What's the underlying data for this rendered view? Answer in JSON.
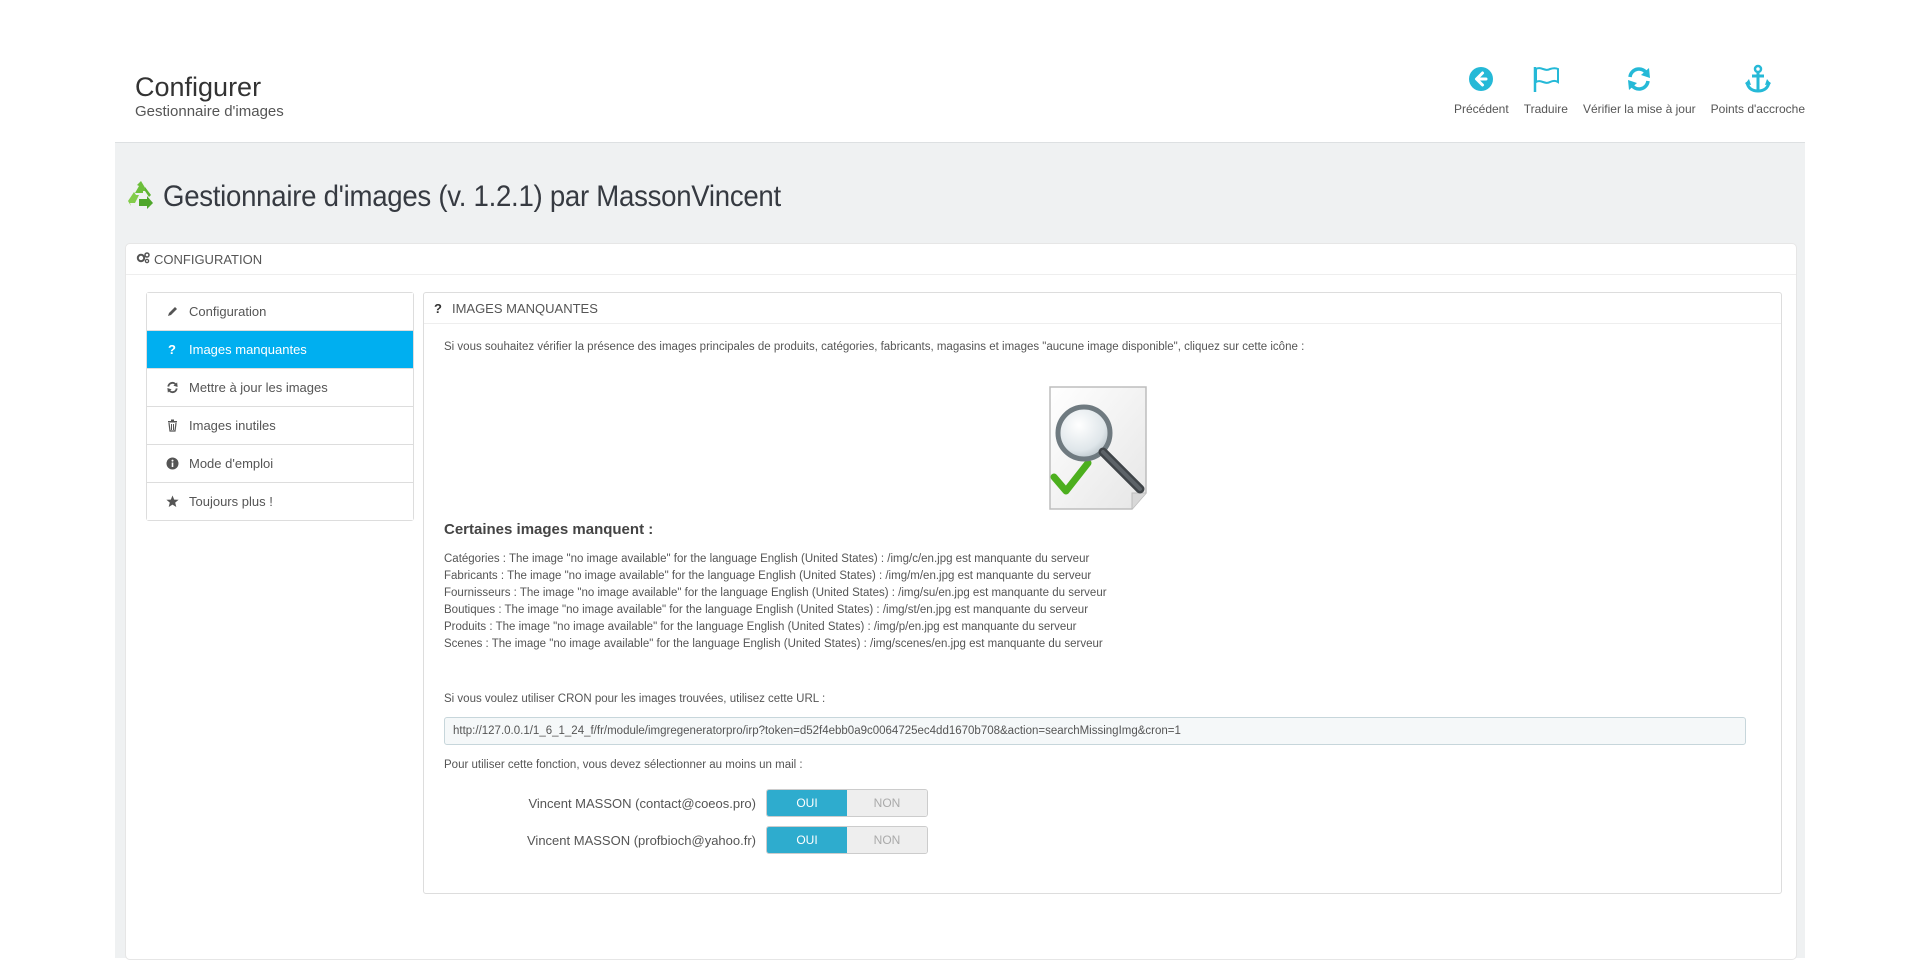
{
  "header": {
    "title": "Configurer",
    "breadcrumb": "Gestionnaire d'images"
  },
  "toolbar": [
    {
      "label": "Précédent",
      "icon": "arrow-circle-left-icon"
    },
    {
      "label": "Traduire",
      "icon": "flag-icon"
    },
    {
      "label": "Vérifier la mise à jour",
      "icon": "refresh-icon"
    },
    {
      "label": "Points d'accroche",
      "icon": "anchor-icon"
    }
  ],
  "module": {
    "title": "Gestionnaire d'images (v. 1.2.1) par MassonVincent",
    "icon": "recycle-icon"
  },
  "panel": {
    "heading": "Configuration"
  },
  "sidebar": {
    "items": [
      {
        "label": "Configuration",
        "icon": "pencil-icon",
        "active": false
      },
      {
        "label": "Images manquantes",
        "icon": "question-icon",
        "active": true
      },
      {
        "label": "Mettre à jour les images",
        "icon": "refresh-icon",
        "active": false
      },
      {
        "label": "Images inutiles",
        "icon": "trash-icon",
        "active": false
      },
      {
        "label": "Mode d'emploi",
        "icon": "info-icon",
        "active": false
      },
      {
        "label": "Toujours plus !",
        "icon": "star-icon",
        "active": false
      }
    ]
  },
  "main": {
    "heading": "Images manquantes",
    "intro": "Si vous souhaitez vérifier la présence des images principales de produits, catégories, fabricants, magasins et images \"aucune image disponible\", cliquez sur cette icône :",
    "missing_title": "Certaines images manquent :",
    "missing_lines": [
      "Catégories : The image \"no image available\" for the language English (United States) : /img/c/en.jpg est manquante du serveur",
      "Fabricants : The image \"no image available\" for the language English (United States) : /img/m/en.jpg est manquante du serveur",
      "Fournisseurs : The image \"no image available\" for the language English (United States) : /img/su/en.jpg est manquante du serveur",
      "Boutiques : The image \"no image available\" for the language English (United States) : /img/st/en.jpg est manquante du serveur",
      "Produits : The image \"no image available\" for the language English (United States) : /img/p/en.jpg est manquante du serveur",
      "Scenes : The image \"no image available\" for the language English (United States) : /img/scenes/en.jpg est manquante du serveur"
    ],
    "cron_label": "Si vous voulez utiliser CRON pour les images trouvées, utilisez cette URL :",
    "cron_url": "http://127.0.0.1/1_6_1_24_f/fr/module/imgregeneratorpro/irp?token=d52f4ebb0a9c0064725ec4dd1670b708&action=searchMissingImg&cron=1",
    "mail_label": "Pour utiliser cette fonction, vous devez sélectionner au moins un mail :",
    "mails": [
      {
        "name": "Vincent MASSON (contact@coeos.pro)",
        "on": "OUI",
        "off": "NON",
        "value": "OUI"
      },
      {
        "name": "Vincent MASSON (profbioch@yahoo.fr)",
        "on": "OUI",
        "off": "NON",
        "value": "OUI"
      }
    ]
  },
  "colors": {
    "accent": "#00aff0",
    "toolbar_icon": "#25b9d7",
    "switch_on": "#2eacce",
    "content_bg": "#eff1f2"
  }
}
